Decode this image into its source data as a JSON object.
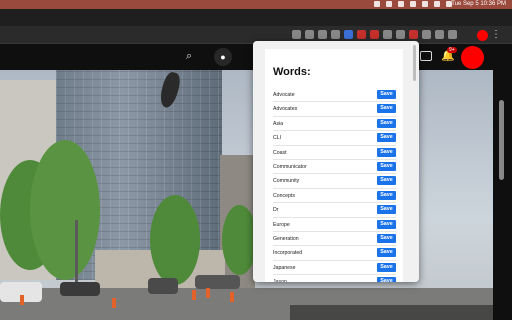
{
  "menubar": {
    "clock": "Tue Sep 5  10:36 PM"
  },
  "popup": {
    "title": "Words:",
    "save_label": "Save",
    "words": [
      "Advocate",
      "Advocates",
      "Asia",
      "CLI",
      "Coast",
      "Communicator",
      "Community",
      "Concepts",
      "Dr",
      "Europe",
      "Generation",
      "Incorporated",
      "Japanese",
      "Jason"
    ]
  },
  "youtube": {
    "notification_count": "9+"
  },
  "colors": {
    "save_button": "#1a73e8",
    "menubar": "#9a4a3c",
    "profile": "#ff0000"
  }
}
